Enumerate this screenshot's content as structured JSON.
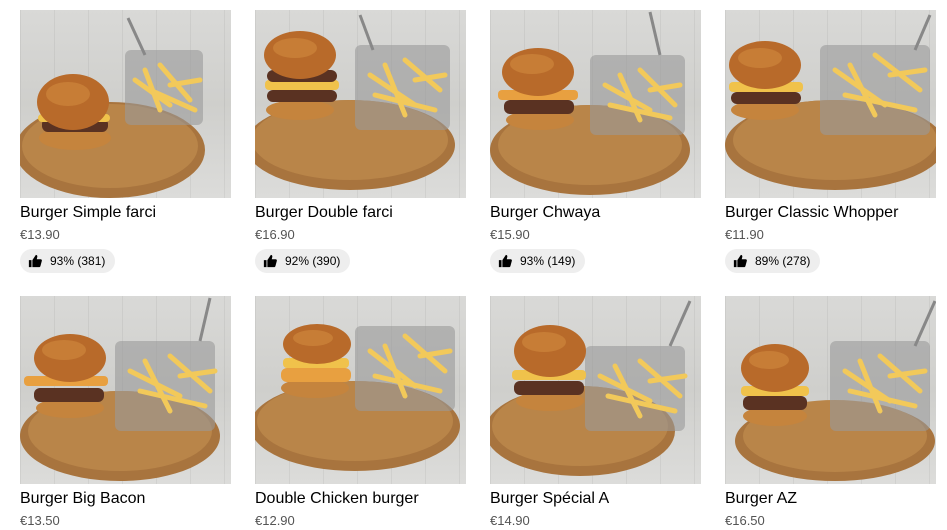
{
  "items": [
    {
      "name": "Burger Simple farci",
      "price": "€13.90",
      "rating": "93% (381)"
    },
    {
      "name": "Burger Double farci",
      "price": "€16.90",
      "rating": "92% (390)"
    },
    {
      "name": "Burger Chwaya",
      "price": "€15.90",
      "rating": "93% (149)"
    },
    {
      "name": "Burger Classic Whopper",
      "price": "€11.90",
      "rating": "89% (278)"
    },
    {
      "name": "Burger Big Bacon",
      "price": "€13.50"
    },
    {
      "name": "Double Chicken burger",
      "price": "€12.90"
    },
    {
      "name": "Burger Spécial A",
      "price": "€14.90"
    },
    {
      "name": "Burger AZ",
      "price": "€16.50"
    }
  ],
  "icons": {
    "rating": "thumbs-up-icon"
  }
}
